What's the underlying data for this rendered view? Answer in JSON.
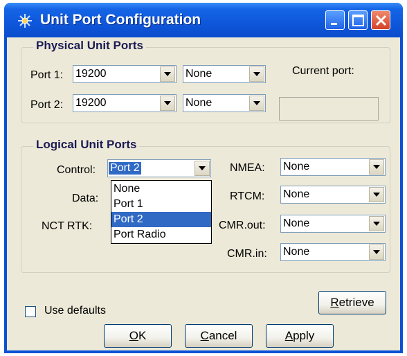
{
  "window": {
    "title": "Unit Port Configuration"
  },
  "physical": {
    "legend": "Physical  Unit Ports",
    "port1": {
      "label": "Port 1:",
      "baud": "19200",
      "mode": "None"
    },
    "port2": {
      "label": "Port 2:",
      "baud": "19200",
      "mode": "None"
    },
    "current_port_label": "Current port:",
    "current_port_value": ""
  },
  "logical": {
    "legend": "Logical Unit Ports",
    "control": {
      "label": "Control:",
      "value": "Port 2"
    },
    "data": {
      "label": "Data:"
    },
    "nct_rtk": {
      "label": "NCT RTK:"
    },
    "dropdown_options": [
      "None",
      "Port 1",
      "Port 2",
      "Port Radio"
    ],
    "dropdown_selected": "Port 2",
    "nmea": {
      "label": "NMEA:",
      "value": "None"
    },
    "rtcm": {
      "label": "RTCM:",
      "value": "None"
    },
    "cmr_out": {
      "label": "CMR.out:",
      "value": "None"
    },
    "cmr_in": {
      "label": "CMR.in:",
      "value": "None"
    }
  },
  "use_defaults": {
    "label": "Use defaults",
    "checked": false
  },
  "buttons": {
    "retrieve_first": "R",
    "retrieve_rest": "etrieve",
    "ok_first": "O",
    "ok_rest": "K",
    "cancel_first": "C",
    "cancel_rest": "ancel",
    "apply_first": "A",
    "apply_rest": "pply"
  },
  "colors": {
    "titlebar": "#0b51d6",
    "client": "#ece9d8",
    "selection": "#316ac5",
    "close": "#d4422a"
  }
}
